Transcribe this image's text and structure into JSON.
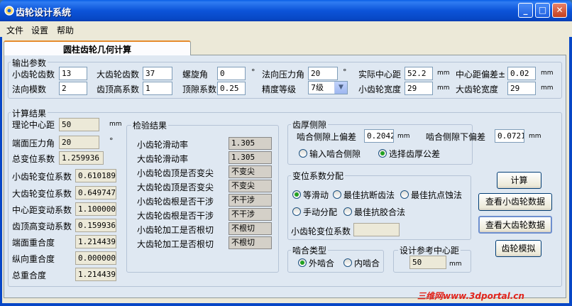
{
  "window": {
    "title": "齿轮设计系统",
    "controls": [
      "_",
      "□",
      "✕"
    ]
  },
  "menu": [
    "文件",
    "设置",
    "帮助"
  ],
  "tab": {
    "label": "圆柱齿轮几何计算"
  },
  "output_params": {
    "title": "输出参数",
    "row1": {
      "small_teeth_label": "小齿轮齿数",
      "small_teeth": "13",
      "big_teeth_label": "大齿轮齿数",
      "big_teeth": "37",
      "helix_label": "螺旋角",
      "helix": "0",
      "helix_unit": "°",
      "pressure_label": "法向压力角",
      "pressure": "20",
      "pressure_unit": "°",
      "center_label": "实际中心距",
      "center": "52.2",
      "center_unit": "mm",
      "dev_label": "中心距偏差±",
      "dev": "0.02",
      "dev_unit": "mm"
    },
    "row2": {
      "module_label": "法向模数",
      "module": "2",
      "addendum_label": "齿顶高系数",
      "addendum": "1",
      "clearance_label": "顶隙系数",
      "clearance": "0.25",
      "grade_label": "精度等级",
      "grade": "7级",
      "small_width_label": "小齿轮宽度",
      "small_width": "29",
      "small_width_unit": "mm",
      "big_width_label": "大齿轮宽度",
      "big_width": "29",
      "big_width_unit": "mm"
    }
  },
  "calc_results": {
    "title": "计算结果",
    "items": [
      {
        "label": "理论中心距",
        "value": "50",
        "unit": "mm"
      },
      {
        "label": "端面压力角",
        "value": "20",
        "unit": "°"
      },
      {
        "label": "总变位系数",
        "value": "1.259936",
        "unit": ""
      },
      {
        "label": "小齿轮变位系数",
        "value": "0.610189",
        "unit": ""
      },
      {
        "label": "大齿轮变位系数",
        "value": "0.649747",
        "unit": ""
      },
      {
        "label": "中心距变动系数",
        "value": "1.100000",
        "unit": ""
      },
      {
        "label": "齿顶高变动系数",
        "value": "0.159936",
        "unit": ""
      },
      {
        "label": "端面重合度",
        "value": "1.214439",
        "unit": ""
      },
      {
        "label": "纵向重合度",
        "value": "0.000000",
        "unit": ""
      },
      {
        "label": "总重合度",
        "value": "1.214439",
        "unit": ""
      }
    ]
  },
  "check_results": {
    "title": "检验结果",
    "items": [
      {
        "label": "小齿轮滑动率",
        "value": "1.305"
      },
      {
        "label": "大齿轮滑动率",
        "value": "1.305"
      },
      {
        "label": "小齿轮齿顶是否变尖",
        "value": "不变尖"
      },
      {
        "label": "大齿轮齿顶是否变尖",
        "value": "不变尖"
      },
      {
        "label": "小齿轮齿根是否干涉",
        "value": "不干涉"
      },
      {
        "label": "大齿轮齿根是否干涉",
        "value": "不干涉"
      },
      {
        "label": "小齿轮加工是否根切",
        "value": "不根切"
      },
      {
        "label": "大齿轮加工是否根切",
        "value": "不根切"
      }
    ]
  },
  "backlash": {
    "title": "齿厚侧隙",
    "upper_label": "啮合侧隙上偏差",
    "upper": "0.2042",
    "upper_unit": "mm",
    "lower_label": "啮合侧隙下偏差",
    "lower": "0.0721",
    "lower_unit": "mm",
    "opt1": "输入啮合侧隙",
    "opt2": "选择齿厚公差",
    "selected": 2
  },
  "shift": {
    "title": "变位系数分配",
    "opts": [
      "等滑动",
      "最佳抗断齿法",
      "最佳抗点蚀法",
      "手动分配",
      "最佳抗胶合法"
    ],
    "selected": 0,
    "small_label": "小齿轮变位系数",
    "small_value": ""
  },
  "mesh": {
    "title": "啮合类型",
    "opt1": "外啮合",
    "opt2": "内啮合",
    "selected": 1
  },
  "design_center": {
    "title": "设计参考中心距",
    "value": "50",
    "unit": "mm"
  },
  "buttons": {
    "calc": "计算",
    "view_small": "查看小齿轮数据",
    "view_big": "查看大齿轮数据",
    "simulate": "齿轮模拟"
  },
  "watermark": "三维网www.3dportal.cn",
  "colors": {
    "titlebar": "#0a5fe6",
    "panel": "#dfe8f2",
    "window": "#ece9d8",
    "radio_on": "#21a121"
  }
}
